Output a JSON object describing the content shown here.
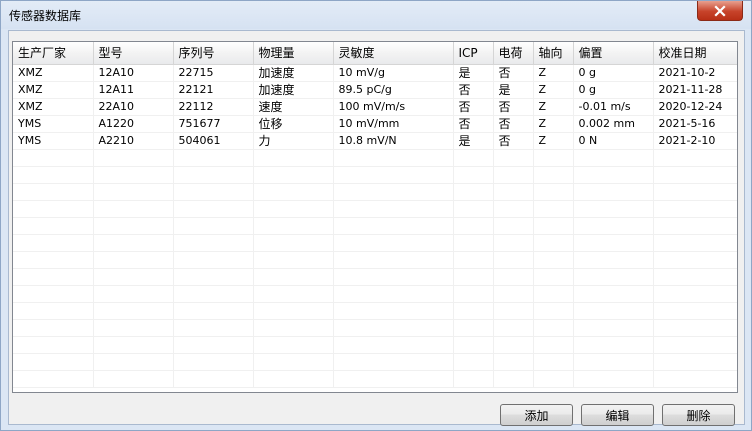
{
  "window": {
    "title": "传感器数据库"
  },
  "table": {
    "columns": [
      "生产厂家",
      "型号",
      "序列号",
      "物理量",
      "灵敏度",
      "ICP",
      "电荷",
      "轴向",
      "偏置",
      "校准日期"
    ],
    "rows": [
      [
        "XMZ",
        "12A10",
        "22715",
        "加速度",
        "10 mV/g",
        "是",
        "否",
        "Z",
        "0 g",
        "2021-10-2"
      ],
      [
        "XMZ",
        "12A11",
        "22121",
        "加速度",
        "89.5 pC/g",
        "否",
        "是",
        "Z",
        "0 g",
        "2021-11-28"
      ],
      [
        "XMZ",
        "22A10",
        "22112",
        "速度",
        "100 mV/m/s",
        "否",
        "否",
        "Z",
        "-0.01 m/s",
        "2020-12-24"
      ],
      [
        "YMS",
        "A1220",
        "751677",
        "位移",
        "10 mV/mm",
        "否",
        "否",
        "Z",
        "0.002 mm",
        "2021-5-16"
      ],
      [
        "YMS",
        "A2210",
        "504061",
        "力",
        "10.8 mV/N",
        "是",
        "否",
        "Z",
        "0 N",
        "2021-2-10"
      ]
    ]
  },
  "buttons": {
    "add": "添加",
    "edit": "编辑",
    "delete": "删除"
  },
  "icons": {
    "close": "close-icon"
  }
}
